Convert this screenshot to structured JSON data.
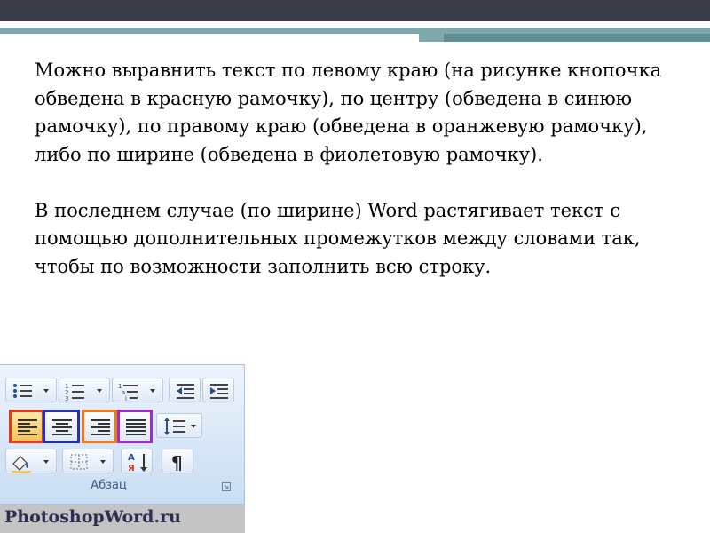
{
  "slide": {
    "paragraph1": "Можно выравнить текст по левому краю (на рисунке кнопочка обведена в красную рамочку), по центру (обведена в синюю рамочку), по правому краю (обведена в оранжевую рамочку), либо по ширине (обведена в фиолетовую рамочку).",
    "paragraph2": "В последнем случае (по ширине) Word растягивает текст с помощью дополнительных промежутков между словами так, чтобы по возможности заполнить всю строку."
  },
  "ribbon": {
    "group_label": "Абзац",
    "watermark": "PhotoshopWord.ru",
    "outline_colors": {
      "align_left": "#e03a1e",
      "align_center": "#2a2fb0",
      "align_right": "#f07a1a",
      "justify": "#9a2fd0"
    },
    "buttons": [
      {
        "icon": "bullets-icon"
      },
      {
        "icon": "numbering-icon"
      },
      {
        "icon": "multilevel-list-icon"
      },
      {
        "icon": "decrease-indent-icon"
      },
      {
        "icon": "increase-indent-icon"
      },
      {
        "icon": "align-left-icon"
      },
      {
        "icon": "align-center-icon"
      },
      {
        "icon": "align-right-icon"
      },
      {
        "icon": "justify-icon"
      },
      {
        "icon": "line-spacing-icon"
      },
      {
        "icon": "shading-icon"
      },
      {
        "icon": "borders-icon"
      },
      {
        "icon": "sort-icon"
      },
      {
        "icon": "pilcrow-icon"
      }
    ]
  }
}
